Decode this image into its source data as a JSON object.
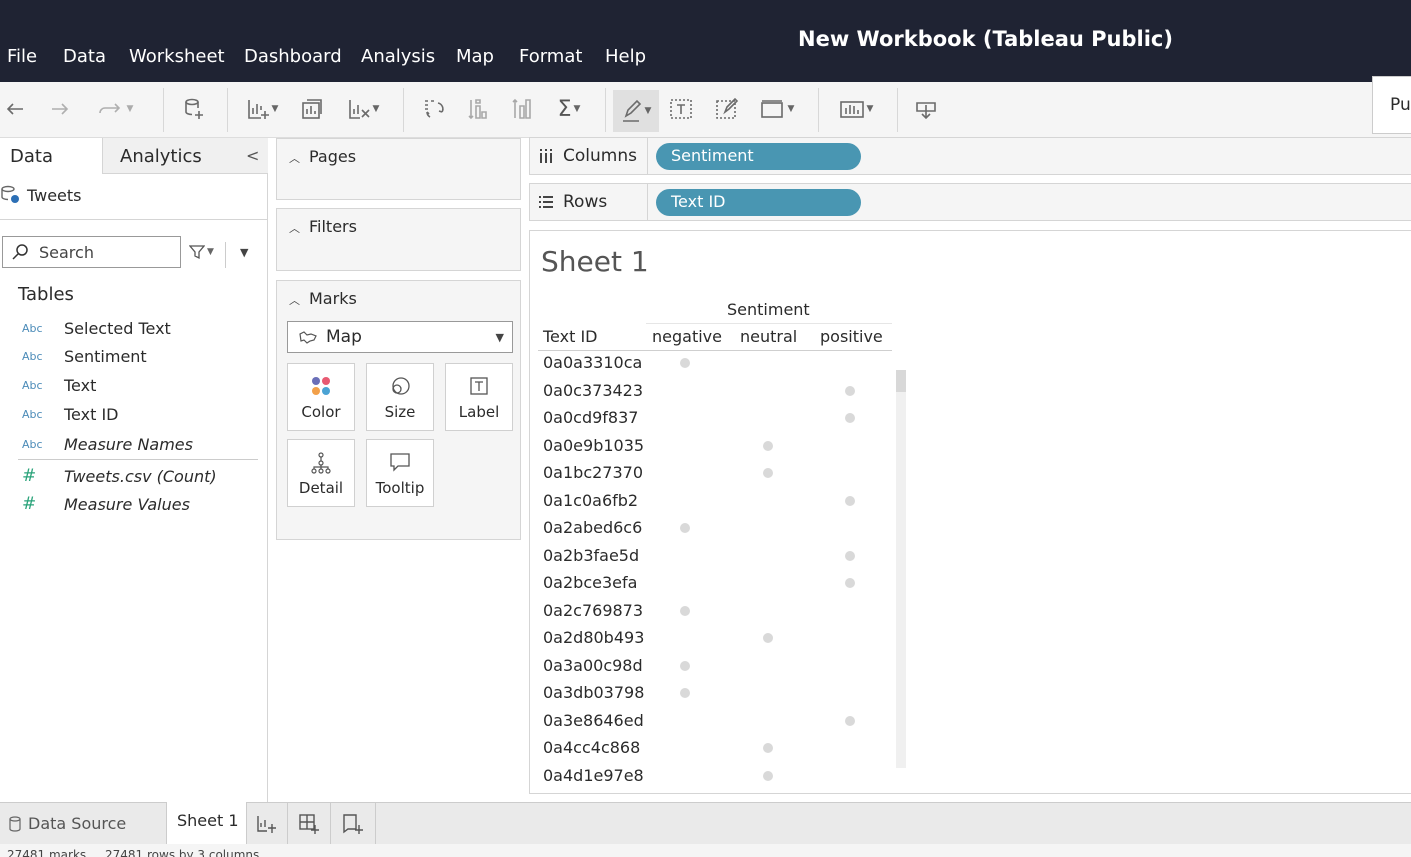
{
  "app": {
    "title": "New Workbook (Tableau Public)",
    "publish_label": "Pu"
  },
  "menu": [
    "File",
    "Data",
    "Worksheet",
    "Dashboard",
    "Analysis",
    "Map",
    "Format",
    "Help"
  ],
  "data_pane": {
    "tabs": [
      "Data",
      "Analytics"
    ],
    "datasource": "Tweets",
    "search_placeholder": "Search",
    "tables_heading": "Tables",
    "fields": [
      {
        "type": "Abc",
        "name": "Selected Text",
        "italic": false
      },
      {
        "type": "Abc",
        "name": "Sentiment",
        "italic": false
      },
      {
        "type": "Abc",
        "name": "Text",
        "italic": false
      },
      {
        "type": "Abc",
        "name": "Text ID",
        "italic": false
      },
      {
        "type": "Abc",
        "name": "Measure Names",
        "italic": true
      }
    ],
    "measures": [
      {
        "type": "#",
        "name": "Tweets.csv (Count)",
        "italic": true
      },
      {
        "type": "#",
        "name": "Measure Values",
        "italic": true
      }
    ]
  },
  "cards": {
    "pages": "Pages",
    "filters": "Filters",
    "marks": "Marks",
    "mark_type": "Map",
    "mark_buttons": [
      "Color",
      "Size",
      "Label",
      "Detail",
      "Tooltip"
    ]
  },
  "shelves": {
    "columns_label": "Columns",
    "columns_pill": "Sentiment",
    "rows_label": "Rows",
    "rows_pill": "Text ID"
  },
  "view": {
    "sheet_title": "Sheet 1",
    "column_field": "Sentiment",
    "row_header": "Text ID",
    "columns": [
      "negative",
      "neutral",
      "positive"
    ],
    "rows": [
      {
        "id": "0a0a3310ca",
        "sentiment": "negative"
      },
      {
        "id": "0a0c373423",
        "sentiment": "positive"
      },
      {
        "id": "0a0cd9f837",
        "sentiment": "positive"
      },
      {
        "id": "0a0e9b1035",
        "sentiment": "neutral"
      },
      {
        "id": "0a1bc27370",
        "sentiment": "neutral"
      },
      {
        "id": "0a1c0a6fb2",
        "sentiment": "positive"
      },
      {
        "id": "0a2abed6c6",
        "sentiment": "negative"
      },
      {
        "id": "0a2b3fae5d",
        "sentiment": "positive"
      },
      {
        "id": "0a2bce3efa",
        "sentiment": "positive"
      },
      {
        "id": "0a2c769873",
        "sentiment": "negative"
      },
      {
        "id": "0a2d80b493",
        "sentiment": "neutral"
      },
      {
        "id": "0a3a00c98d",
        "sentiment": "negative"
      },
      {
        "id": "0a3db03798",
        "sentiment": "negative"
      },
      {
        "id": "0a3e8646ed",
        "sentiment": "positive"
      },
      {
        "id": "0a4cc4c868",
        "sentiment": "neutral"
      },
      {
        "id": "0a4d1e97e8",
        "sentiment": "neutral"
      }
    ]
  },
  "bottom_tabs": {
    "data_source": "Data Source",
    "sheet": "Sheet 1"
  },
  "status": {
    "marks": "27481 marks",
    "rows": "27481 rows by 3 columns"
  },
  "colors": {
    "topbar": "#1f2333",
    "pill": "#4996b2",
    "mark": "#d9d9d9",
    "abc": "#4b8bb8",
    "measure": "#2aa37a"
  }
}
